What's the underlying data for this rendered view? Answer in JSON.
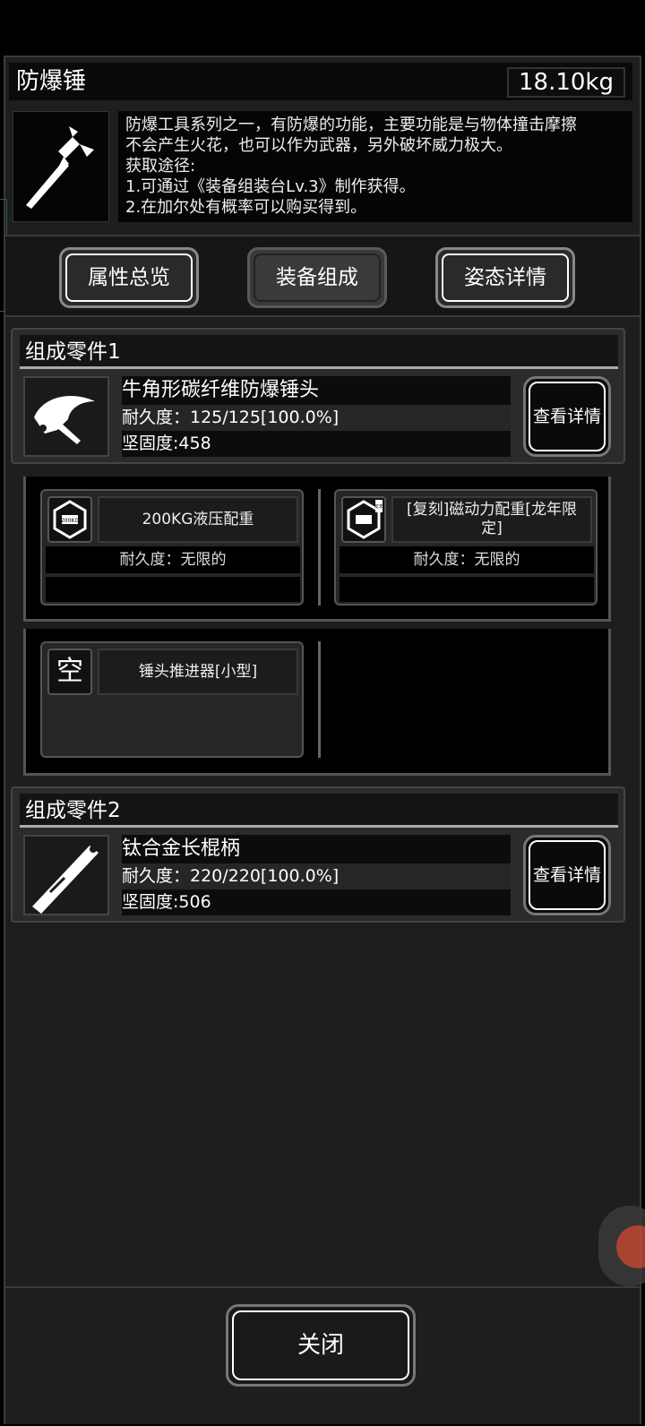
{
  "header": {
    "title": "防爆锤",
    "weight": "18.10kg"
  },
  "description": {
    "lines": [
      "防爆工具系列之一，有防爆的功能，主要功能是与物体撞击摩擦",
      "不会产生火花，也可以作为武器，另外破坏威力极大。",
      "获取途径:",
      "1.可通过《装备组装台Lv.3》制作获得。",
      "2.在加尔处有概率可以购买得到。"
    ]
  },
  "tabs": [
    {
      "label": "属性总览"
    },
    {
      "label": "装备组成"
    },
    {
      "label": "姿态详情"
    }
  ],
  "parts": [
    {
      "heading": "组成零件1",
      "name": "牛角形碳纤维防爆锤头",
      "durability": "耐久度：125/125[100.0%]",
      "firmness": "坚固度:458",
      "detail_label": "查看详情"
    },
    {
      "heading": "组成零件2",
      "name": "钛合金长棍柄",
      "durability": "耐久度：220/220[100.0%]",
      "firmness": "坚固度:506",
      "detail_label": "查看详情"
    }
  ],
  "slots": [
    {
      "name": "200KG液压配重",
      "durability": "耐久度：无限的",
      "icon_label": "200KG"
    },
    {
      "name": "[复刻]磁动力配重[龙年限定]",
      "durability": "耐久度：无限的",
      "icon_label": "龙年"
    },
    {
      "name": "锤头推进器[小型]",
      "empty_glyph": "空"
    }
  ],
  "footer": {
    "close_label": "关闭"
  }
}
